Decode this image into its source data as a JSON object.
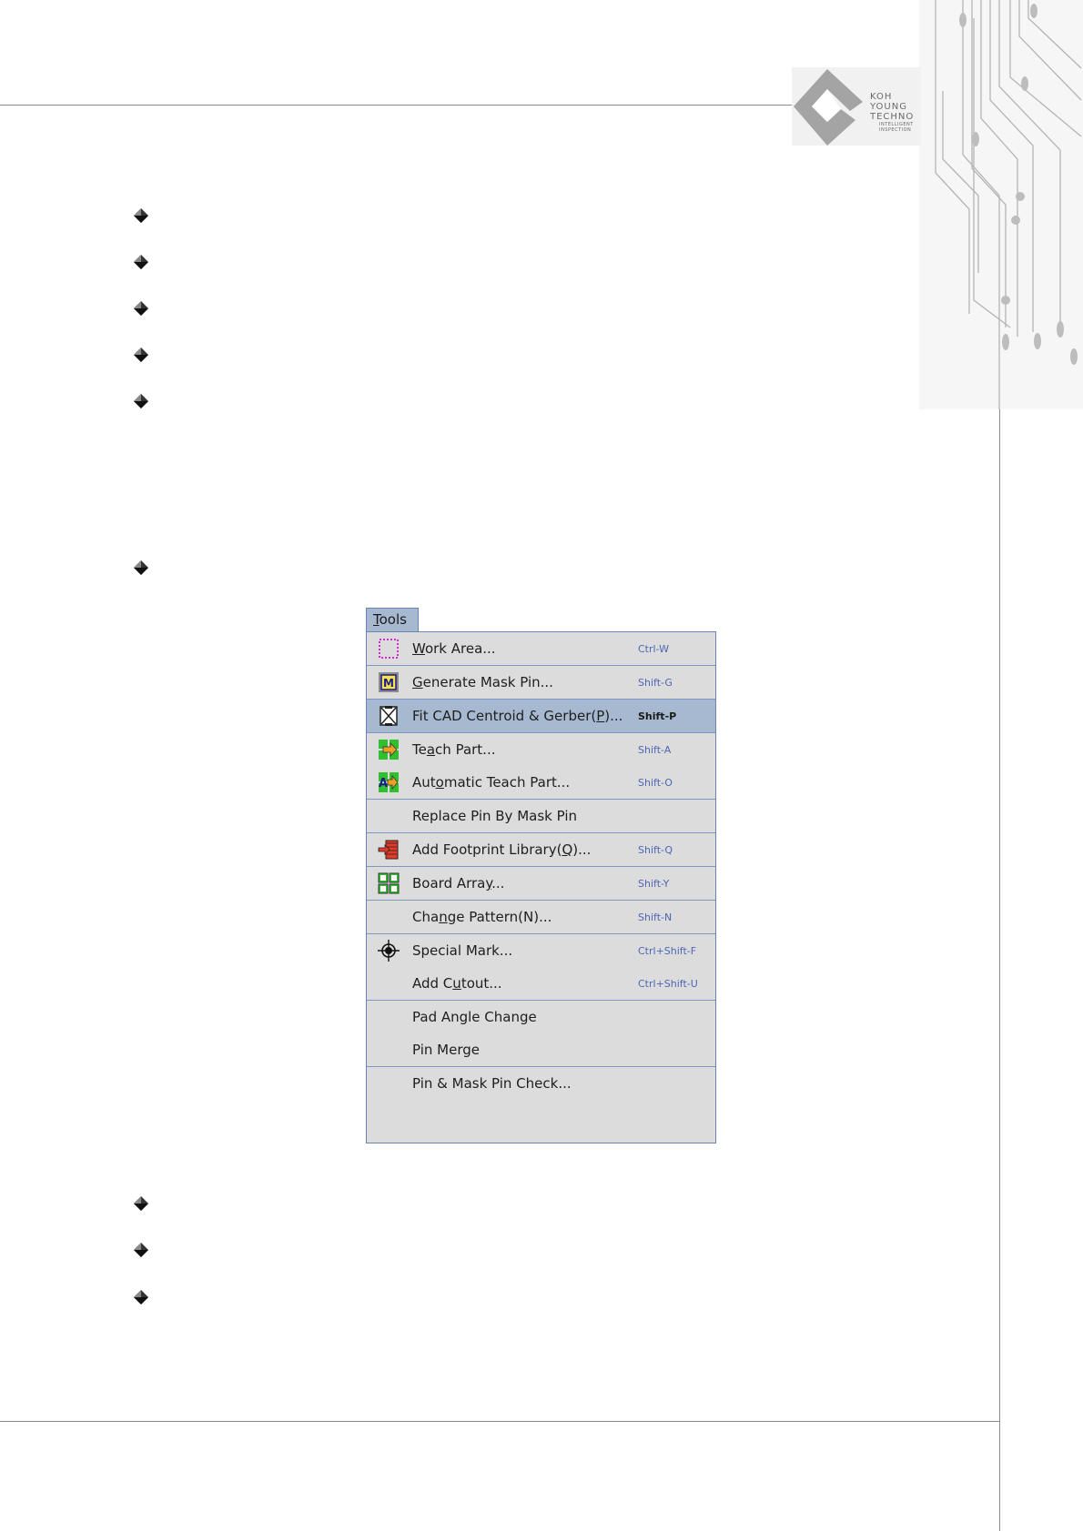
{
  "logo": {
    "line1": "KOH",
    "line2": "YOUNG",
    "line3": "TECHNO",
    "line4": "INTELLIGENT",
    "line5": "INSPECTION"
  },
  "menu": {
    "title_prefix": "",
    "title_mnemonic": "T",
    "title_rest": "ools",
    "items": [
      {
        "pre": "",
        "mn": "W",
        "post": "ork Area...",
        "shortcut": "Ctrl-W",
        "icon": "dotted-rect-icon"
      },
      {
        "pre": "",
        "mn": "G",
        "post": "enerate Mask Pin...",
        "shortcut": "Shift-G",
        "icon": "mask-m-icon"
      },
      {
        "pre": "Fit CAD Centroid & Gerber(",
        "mn": "P",
        "post": ")...",
        "shortcut": "Shift-P",
        "icon": "fit-cad-icon",
        "highlighted": true
      },
      {
        "pre": "Te",
        "mn": "a",
        "post": "ch Part...",
        "shortcut": "Shift-A",
        "icon": "teach-part-icon"
      },
      {
        "pre": "Aut",
        "mn": "o",
        "post": "matic Teach Part...",
        "shortcut": "Shift-O",
        "icon": "auto-teach-icon"
      },
      {
        "pre": "Replace Pin By Mask Pin",
        "mn": "",
        "post": "",
        "shortcut": "",
        "icon": ""
      },
      {
        "pre": "Add Footprint Library(",
        "mn": "Q",
        "post": ")...",
        "shortcut": "Shift-Q",
        "icon": "footprint-library-icon"
      },
      {
        "pre": "Board Arra",
        "mn": "y",
        "post": "...",
        "shortcut": "Shift-Y",
        "icon": "board-array-icon"
      },
      {
        "pre": "Cha",
        "mn": "n",
        "post": "ge Pattern(N)...",
        "shortcut": "Shift-N",
        "icon": ""
      },
      {
        "pre": "Special Mark...",
        "mn": "",
        "post": "",
        "shortcut": "Ctrl+Shift-F",
        "icon": "crosshair-icon"
      },
      {
        "pre": "Add C",
        "mn": "u",
        "post": "tout...",
        "shortcut": "Ctrl+Shift-U",
        "icon": ""
      },
      {
        "pre": "Pad Angle Change",
        "mn": "",
        "post": "",
        "shortcut": "",
        "icon": ""
      },
      {
        "pre": "Pin Merge",
        "mn": "",
        "post": "",
        "shortcut": "",
        "icon": ""
      },
      {
        "pre": "Pin & Mask Pin Check...",
        "mn": "",
        "post": "",
        "shortcut": "",
        "icon": ""
      }
    ]
  },
  "colors": {
    "menu_bg": "#dcdcdc",
    "menu_highlight": "#a7b9d1",
    "menu_border": "#6d83b5",
    "shortcut_text": "#4d66b5"
  }
}
